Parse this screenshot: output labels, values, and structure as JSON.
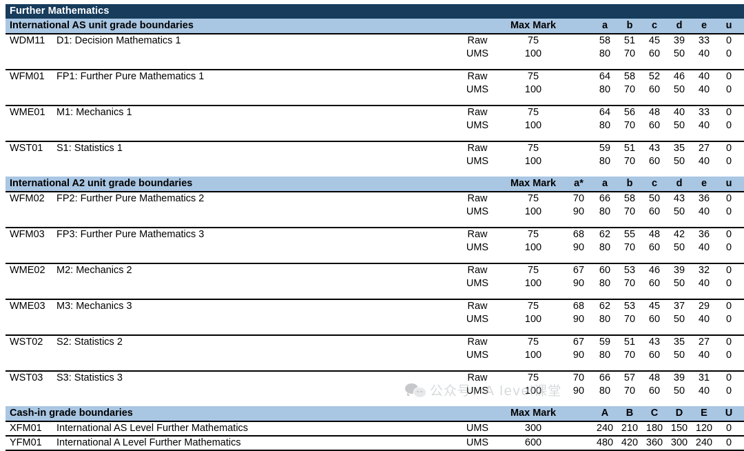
{
  "document": {
    "title": "Further Mathematics"
  },
  "sections": [
    {
      "id": "as-units",
      "heading": "International AS unit grade boundaries",
      "max_mark_label": "Max Mark",
      "grade_columns": [
        "a",
        "b",
        "c",
        "d",
        "e",
        "u"
      ],
      "has_astar": false,
      "rows": [
        {
          "code": "WDM11",
          "name": "D1: Decision Mathematics 1",
          "lines": [
            {
              "type": "Raw",
              "max": "75",
              "grades": [
                "58",
                "51",
                "45",
                "39",
                "33",
                "0"
              ]
            },
            {
              "type": "UMS",
              "max": "100",
              "grades": [
                "80",
                "70",
                "60",
                "50",
                "40",
                "0"
              ]
            }
          ]
        },
        {
          "code": "WFM01",
          "name": "FP1: Further Pure Mathematics 1",
          "lines": [
            {
              "type": "Raw",
              "max": "75",
              "grades": [
                "64",
                "58",
                "52",
                "46",
                "40",
                "0"
              ]
            },
            {
              "type": "UMS",
              "max": "100",
              "grades": [
                "80",
                "70",
                "60",
                "50",
                "40",
                "0"
              ]
            }
          ]
        },
        {
          "code": "WME01",
          "name": "M1: Mechanics 1",
          "lines": [
            {
              "type": "Raw",
              "max": "75",
              "grades": [
                "64",
                "56",
                "48",
                "40",
                "33",
                "0"
              ]
            },
            {
              "type": "UMS",
              "max": "100",
              "grades": [
                "80",
                "70",
                "60",
                "50",
                "40",
                "0"
              ]
            }
          ]
        },
        {
          "code": "WST01",
          "name": "S1: Statistics 1",
          "lines": [
            {
              "type": "Raw",
              "max": "75",
              "grades": [
                "59",
                "51",
                "43",
                "35",
                "27",
                "0"
              ]
            },
            {
              "type": "UMS",
              "max": "100",
              "grades": [
                "80",
                "70",
                "60",
                "50",
                "40",
                "0"
              ]
            }
          ]
        }
      ]
    },
    {
      "id": "a2-units",
      "heading": "International A2 unit grade boundaries",
      "max_mark_label": "Max Mark",
      "grade_columns": [
        "a*",
        "a",
        "b",
        "c",
        "d",
        "e",
        "u"
      ],
      "has_astar": true,
      "rows": [
        {
          "code": "WFM02",
          "name": "FP2: Further Pure Mathematics 2",
          "lines": [
            {
              "type": "Raw",
              "max": "75",
              "grades": [
                "70",
                "66",
                "58",
                "50",
                "43",
                "36",
                "0"
              ]
            },
            {
              "type": "UMS",
              "max": "100",
              "grades": [
                "90",
                "80",
                "70",
                "60",
                "50",
                "40",
                "0"
              ]
            }
          ]
        },
        {
          "code": "WFM03",
          "name": "FP3: Further Pure Mathematics 3",
          "lines": [
            {
              "type": "Raw",
              "max": "75",
              "grades": [
                "68",
                "62",
                "55",
                "48",
                "42",
                "36",
                "0"
              ]
            },
            {
              "type": "UMS",
              "max": "100",
              "grades": [
                "90",
                "80",
                "70",
                "60",
                "50",
                "40",
                "0"
              ]
            }
          ]
        },
        {
          "code": "WME02",
          "name": "M2: Mechanics 2",
          "lines": [
            {
              "type": "Raw",
              "max": "75",
              "grades": [
                "67",
                "60",
                "53",
                "46",
                "39",
                "32",
                "0"
              ]
            },
            {
              "type": "UMS",
              "max": "100",
              "grades": [
                "90",
                "80",
                "70",
                "60",
                "50",
                "40",
                "0"
              ]
            }
          ]
        },
        {
          "code": "WME03",
          "name": "M3: Mechanics 3",
          "lines": [
            {
              "type": "Raw",
              "max": "75",
              "grades": [
                "68",
                "62",
                "53",
                "45",
                "37",
                "29",
                "0"
              ]
            },
            {
              "type": "UMS",
              "max": "100",
              "grades": [
                "90",
                "80",
                "70",
                "60",
                "50",
                "40",
                "0"
              ]
            }
          ]
        },
        {
          "code": "WST02",
          "name": "S2: Statistics 2",
          "lines": [
            {
              "type": "Raw",
              "max": "75",
              "grades": [
                "67",
                "59",
                "51",
                "43",
                "35",
                "27",
                "0"
              ]
            },
            {
              "type": "UMS",
              "max": "100",
              "grades": [
                "90",
                "80",
                "70",
                "60",
                "50",
                "40",
                "0"
              ]
            }
          ]
        },
        {
          "code": "WST03",
          "name": "S3: Statistics 3",
          "lines": [
            {
              "type": "Raw",
              "max": "75",
              "grades": [
                "70",
                "66",
                "57",
                "48",
                "39",
                "31",
                "0"
              ]
            },
            {
              "type": "UMS",
              "max": "100",
              "grades": [
                "90",
                "80",
                "70",
                "60",
                "50",
                "40",
                "0"
              ]
            }
          ]
        }
      ]
    },
    {
      "id": "cash-in",
      "heading": "Cash-in grade boundaries",
      "max_mark_label": "Max Mark",
      "grade_columns": [
        "A",
        "B",
        "C",
        "D",
        "E",
        "U"
      ],
      "has_astar": false,
      "rows": [
        {
          "code": "XFM01",
          "name": "International AS Level Further Mathematics",
          "lines": [
            {
              "type": "UMS",
              "max": "300",
              "grades": [
                "240",
                "210",
                "180",
                "150",
                "120",
                "0"
              ]
            }
          ]
        },
        {
          "code": "YFM01",
          "name": "International A Level Further Mathematics",
          "lines": [
            {
              "type": "UMS",
              "max": "600",
              "grades": [
                "480",
                "420",
                "360",
                "300",
                "240",
                "0"
              ]
            }
          ]
        }
      ]
    }
  ],
  "watermark": {
    "text": "公众号：A level课堂",
    "icon": "wechat-icon"
  },
  "colors": {
    "title_bar": "#173c5c",
    "section_bar": "#a9c6e3",
    "rule": "#000000",
    "text": "#000000"
  }
}
